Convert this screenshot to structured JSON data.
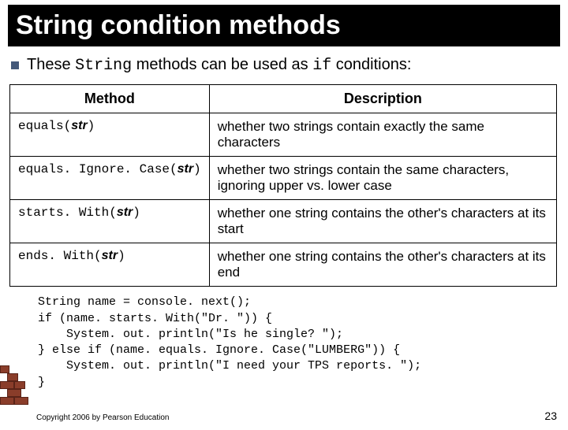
{
  "title": "String condition methods",
  "intro": {
    "prefix": "These ",
    "code1": "String",
    "mid": " methods can be used as ",
    "code2": "if",
    "suffix": " conditions:"
  },
  "table": {
    "headers": {
      "method": "Method",
      "description": "Description"
    },
    "rows": [
      {
        "method_prefix": "equals(",
        "param": "str",
        "method_suffix": ")",
        "description": "whether two strings contain exactly the same characters"
      },
      {
        "method_prefix": "equals. Ignore. Case(",
        "param": "str",
        "method_suffix": ")",
        "description": "whether two strings contain the same characters, ignoring upper vs. lower case"
      },
      {
        "method_prefix": "starts. With(",
        "param": "str",
        "method_suffix": ")",
        "description": "whether one string contains the other's characters at its start"
      },
      {
        "method_prefix": "ends. With(",
        "param": "str",
        "method_suffix": ")",
        "description": "whether one string contains the other's characters at its end"
      }
    ]
  },
  "code": "String name = console. next();\nif (name. starts. With(\"Dr. \")) {\n    System. out. println(\"Is he single? \");\n} else if (name. equals. Ignore. Case(\"LUMBERG\")) {\n    System. out. println(\"I need your TPS reports. \");\n}",
  "footer": "Copyright 2006 by Pearson Education",
  "page_number": "23"
}
